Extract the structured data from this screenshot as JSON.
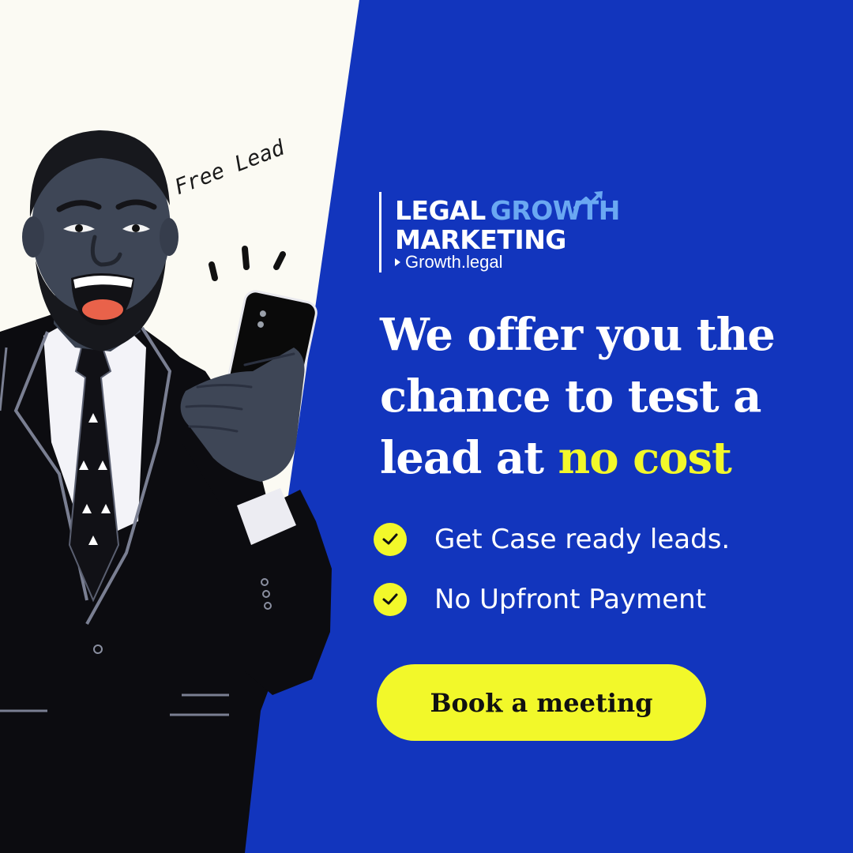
{
  "brand": {
    "name_part1": "LEGAL",
    "name_part2": "GROWTH",
    "name_line2": "MARKETING",
    "website": "Growth.legal"
  },
  "illustration": {
    "speech_text": "Free Lead"
  },
  "headline": {
    "line1": "We offer you the",
    "line2": "chance to test a",
    "line3_start": "lead at",
    "line3_highlight": "no cost"
  },
  "benefits": [
    {
      "text": "Get Case ready leads.",
      "icon": "check-icon"
    },
    {
      "text": "No Upfront Payment",
      "icon": "check-icon"
    }
  ],
  "cta": {
    "label": "Book a meeting"
  },
  "colors": {
    "background_light": "#fbfaf3",
    "panel_blue": "#1235bd",
    "accent_yellow": "#f2f82a",
    "logo_light_blue": "#6aa8f2",
    "text_white": "#ffffff"
  }
}
